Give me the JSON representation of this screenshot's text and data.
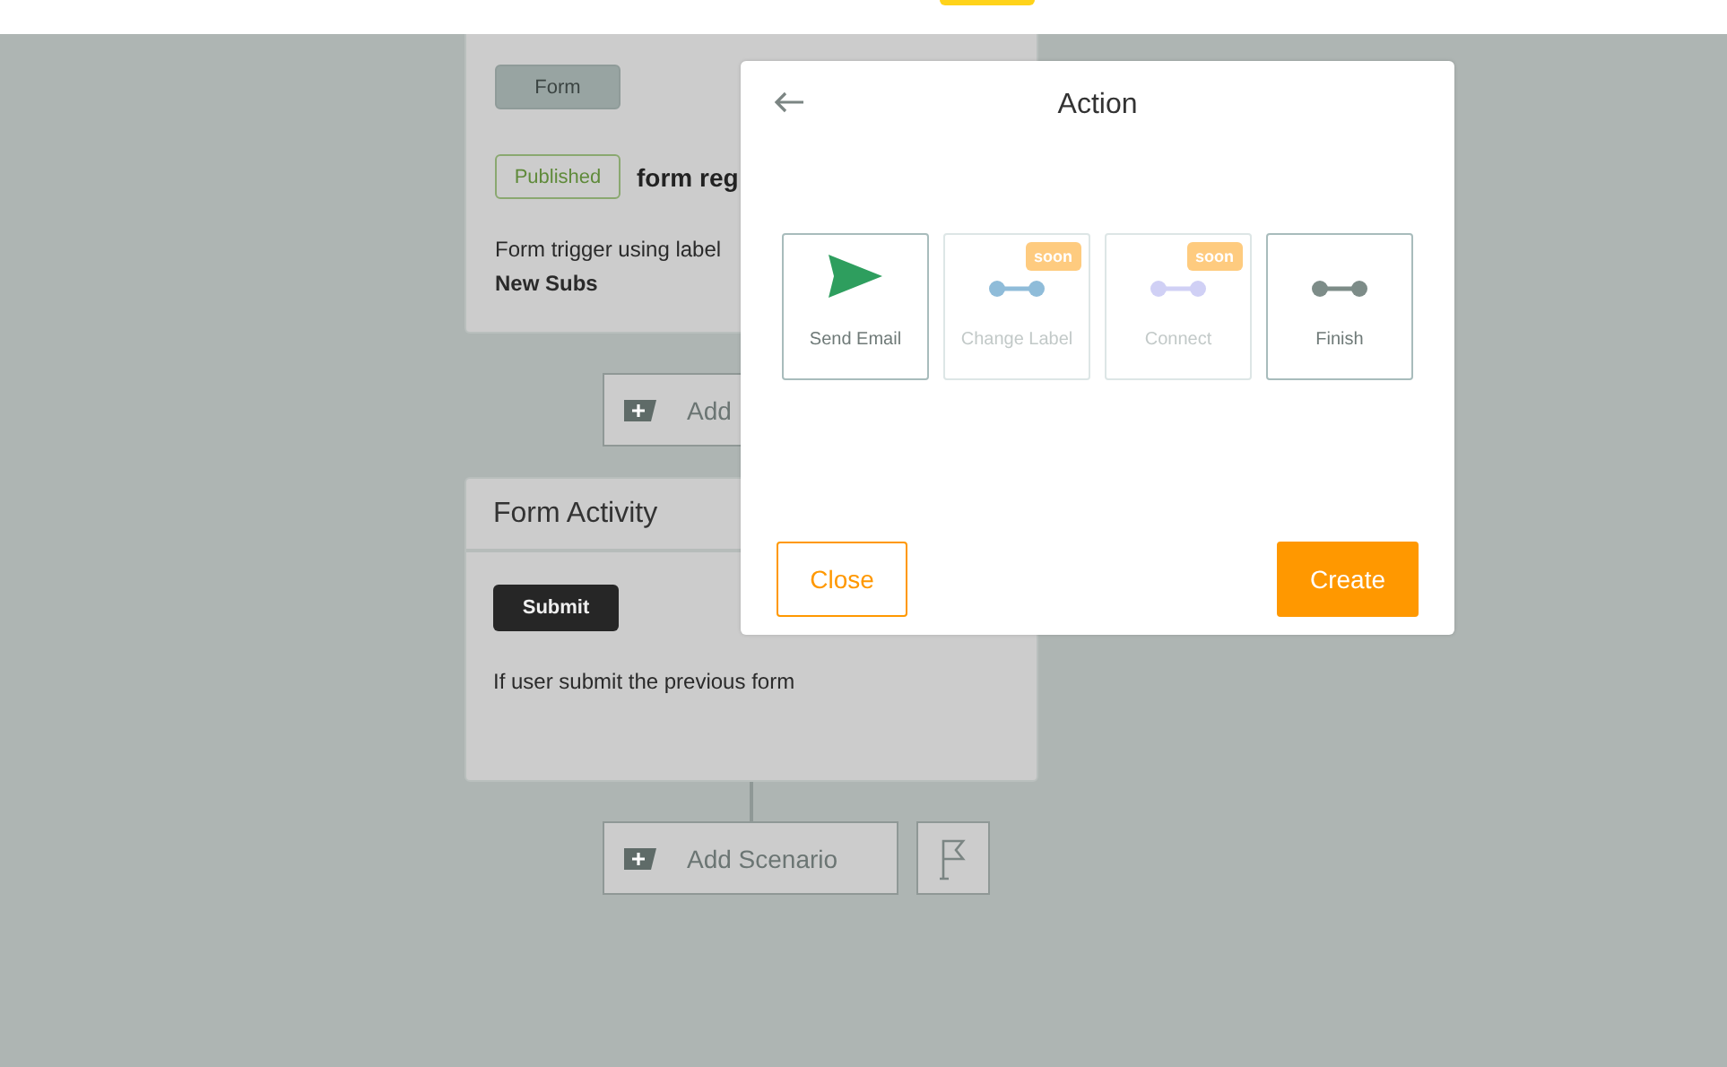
{
  "canvas": {
    "trigger_card": {
      "tag": "Form",
      "status": "Published",
      "title": "form reg",
      "description": "Form trigger using label",
      "label": "New Subs"
    },
    "add_scenario_top": {
      "label": "Add"
    },
    "activity_card": {
      "title": "Form Activity",
      "tag": "Submit",
      "description": "If user submit the previous form"
    },
    "add_scenario_bottom": {
      "label": "Add Scenario"
    }
  },
  "dialog": {
    "title": "Action",
    "actions": [
      {
        "kind": "send",
        "label": "Send Email",
        "disabled": false,
        "color": "#2e9e5e"
      },
      {
        "kind": "connector",
        "label": "Change Label",
        "disabled": true,
        "badge": "soon",
        "color": "#8fbcd9"
      },
      {
        "kind": "connector",
        "label": "Connect",
        "disabled": true,
        "badge": "soon",
        "color": "#d0d0f5"
      },
      {
        "kind": "connector",
        "label": "Finish",
        "disabled": false,
        "color": "#7d8c88"
      }
    ],
    "buttons": {
      "close": "Close",
      "create": "Create"
    }
  }
}
